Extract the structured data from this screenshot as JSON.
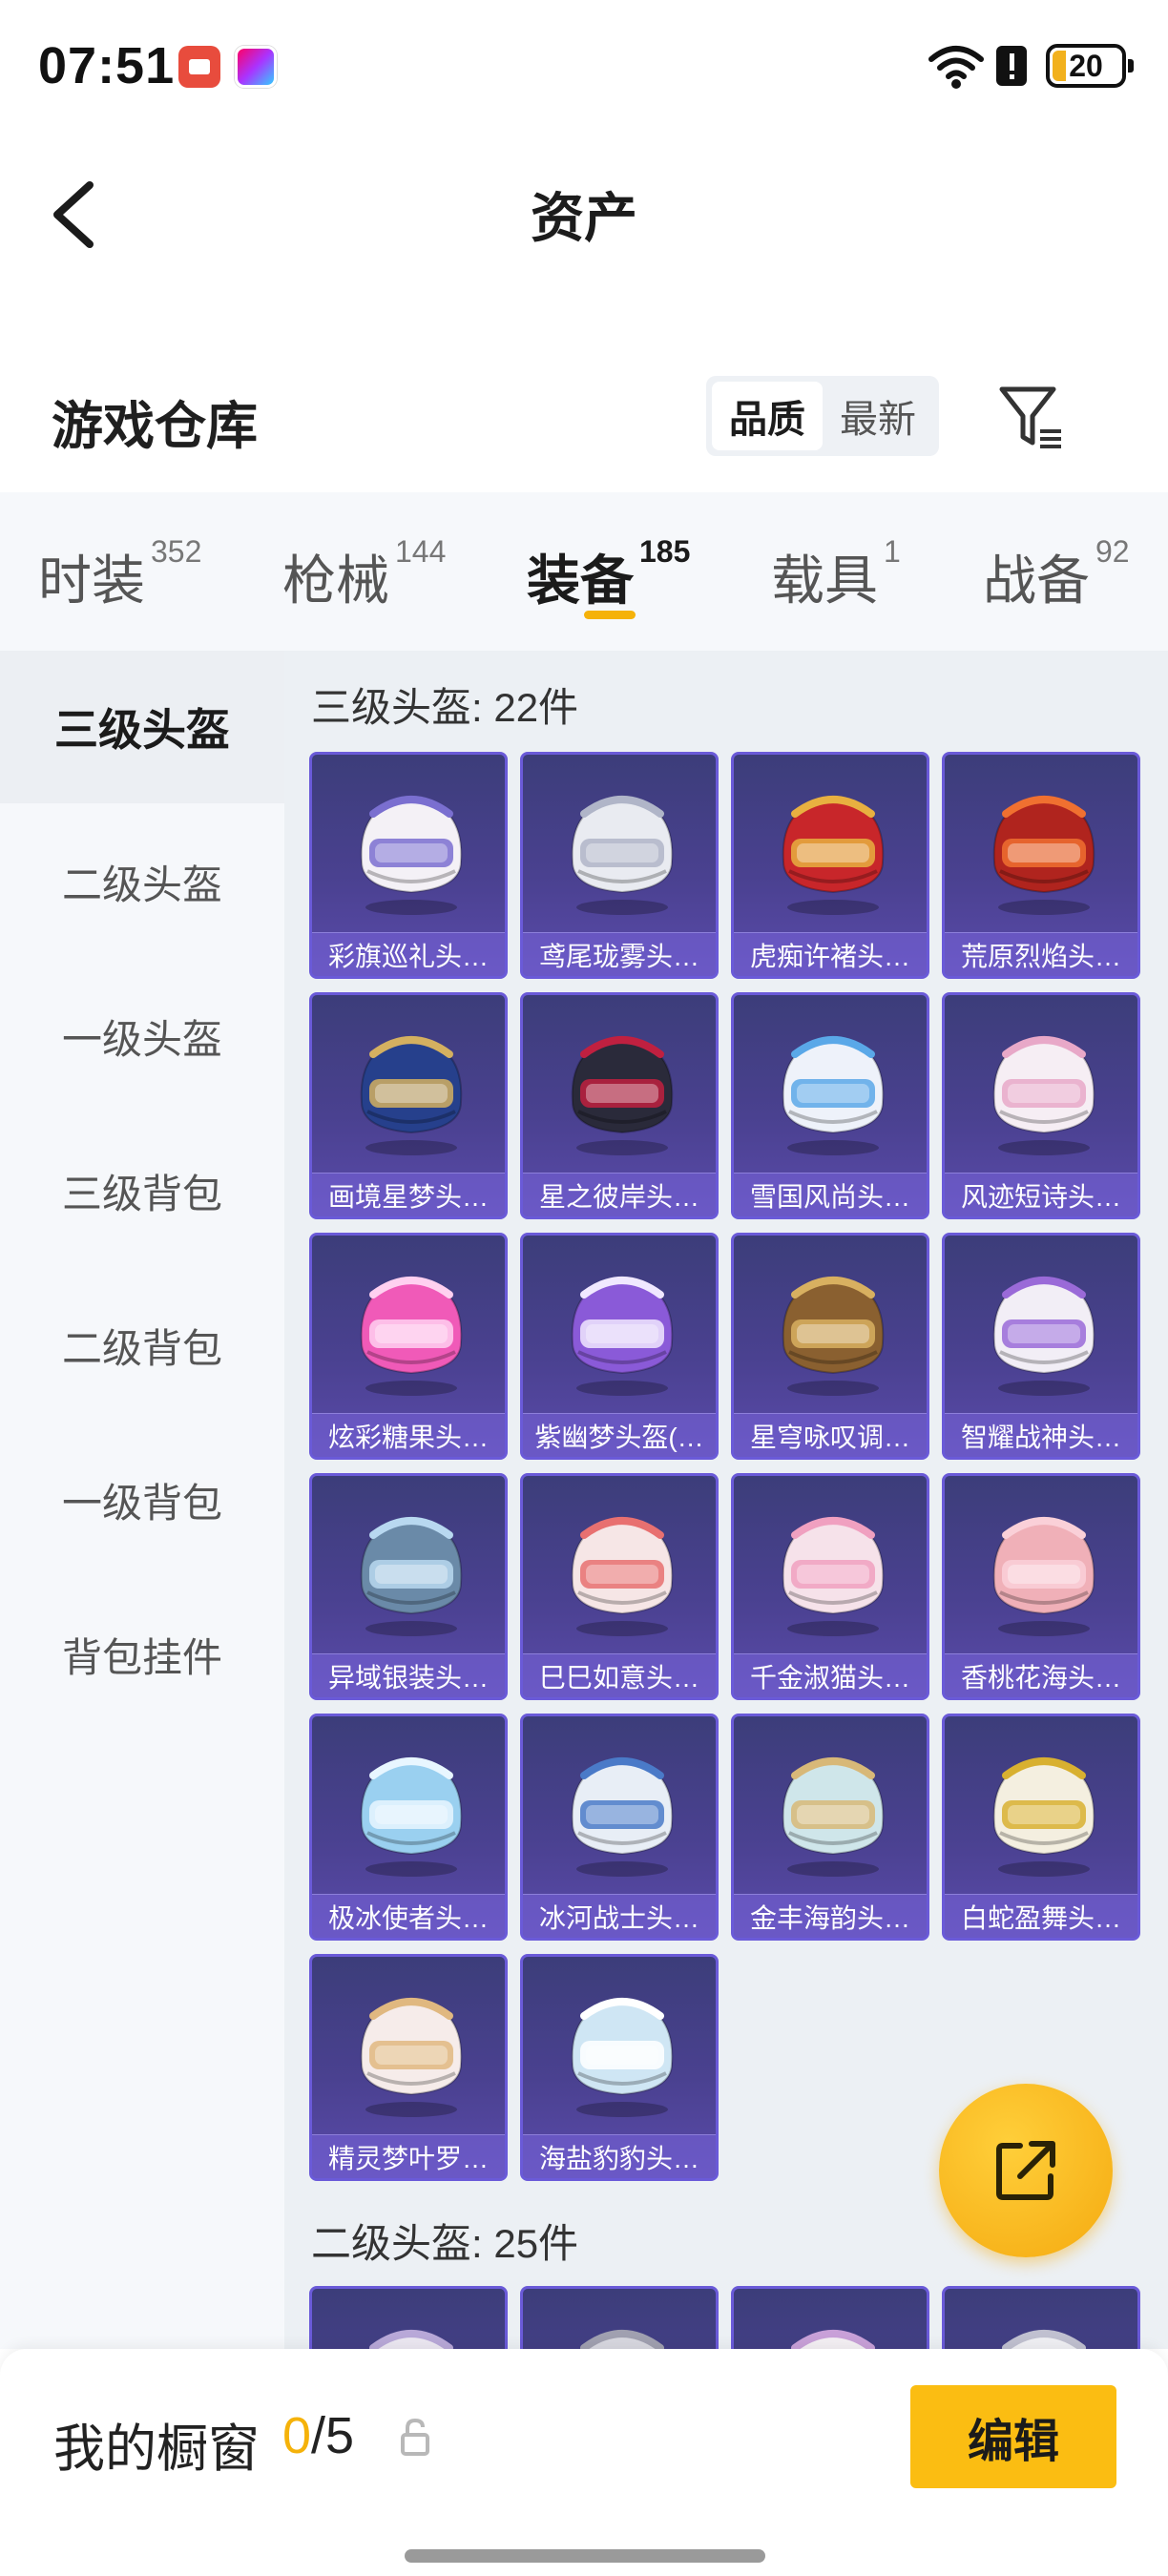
{
  "status_bar": {
    "time": "07:51",
    "battery": "20",
    "icons": [
      "recorder-app-icon",
      "app-icon",
      "wifi-icon",
      "alert-icon",
      "battery-icon"
    ]
  },
  "header": {
    "title": "资产",
    "back_icon": "chevron-left-icon"
  },
  "warehouse": {
    "title": "游戏仓库",
    "sort_options": [
      "品质",
      "最新"
    ],
    "sort_selected": "品质",
    "filter_icon": "filter-icon"
  },
  "tabs": [
    {
      "label": "时装",
      "count": "352"
    },
    {
      "label": "枪械",
      "count": "144"
    },
    {
      "label": "装备",
      "count": "185",
      "active": true
    },
    {
      "label": "载具",
      "count": "1"
    },
    {
      "label": "战备",
      "count": "92"
    }
  ],
  "sidebar": {
    "items": [
      "三级头盔",
      "二级头盔",
      "一级头盔",
      "三级背包",
      "二级背包",
      "一级背包",
      "背包挂件"
    ],
    "active": "三级头盔"
  },
  "sections": [
    {
      "title": "三级头盔: 22件",
      "items": [
        {
          "name": "彩旗巡礼头…",
          "color": "#f4f1f6",
          "accent": "#7a6fd0"
        },
        {
          "name": "鸢尾珑雾头…",
          "color": "#e9ebf1",
          "accent": "#b0b5c8"
        },
        {
          "name": "虎痴许褚头…",
          "color": "#c8262a",
          "accent": "#e8b040"
        },
        {
          "name": "荒原烈焰头…",
          "color": "#b0241e",
          "accent": "#f07030"
        },
        {
          "name": "画境星梦头…",
          "color": "#26408c",
          "accent": "#d4b060"
        },
        {
          "name": "星之彼岸头…",
          "color": "#2a2a3a",
          "accent": "#c02040"
        },
        {
          "name": "雪国风尚头…",
          "color": "#eef2fa",
          "accent": "#5aa8e8"
        },
        {
          "name": "风迹短诗头…",
          "color": "#f6eef4",
          "accent": "#e8a8c8"
        },
        {
          "name": "炫彩糖果头…",
          "color": "#f05ab8",
          "accent": "#ffd0f0"
        },
        {
          "name": "紫幽梦头盔(…",
          "color": "#8a5ad8",
          "accent": "#f0e8ff"
        },
        {
          "name": "星穹咏叹调…",
          "color": "#8a6030",
          "accent": "#d8b060"
        },
        {
          "name": "智耀战神头…",
          "color": "#f2eef6",
          "accent": "#9a6ad8"
        },
        {
          "name": "异域银装头…",
          "color": "#6a8aa8",
          "accent": "#b8d8f0"
        },
        {
          "name": "巳巳如意头…",
          "color": "#f6e6e6",
          "accent": "#e87070"
        },
        {
          "name": "千金淑猫头…",
          "color": "#f6e2ea",
          "accent": "#f0a0c0"
        },
        {
          "name": "香桃花海头…",
          "color": "#f0b0b8",
          "accent": "#fad0d8"
        },
        {
          "name": "极冰使者头…",
          "color": "#9ad0f0",
          "accent": "#e8f6ff"
        },
        {
          "name": "冰河战士头…",
          "color": "#e8eef6",
          "accent": "#4a7ac8"
        },
        {
          "name": "金丰海韵头…",
          "color": "#cfe6ea",
          "accent": "#d8b878"
        },
        {
          "name": "白蛇盈舞头…",
          "color": "#f4efe0",
          "accent": "#d8b030"
        },
        {
          "name": "精灵梦叶罗…",
          "color": "#f6ecea",
          "accent": "#e0b880"
        },
        {
          "name": "海盐豹豹头…",
          "color": "#cfe6f4",
          "accent": "#ffffff"
        }
      ]
    },
    {
      "title": "二级头盔: 25件",
      "items": [
        {
          "name": "",
          "color": "#ece8f2",
          "accent": "#b8a8d8"
        },
        {
          "name": "",
          "color": "#d8d8e0",
          "accent": "#a0a0b0"
        },
        {
          "name": "",
          "color": "#f4f0f4",
          "accent": "#c8a0d8"
        },
        {
          "name": "",
          "color": "#f0f0f4",
          "accent": "#c0c0d0"
        }
      ]
    }
  ],
  "bottom_bar": {
    "title": "我的橱窗",
    "count_current": "0",
    "count_sep_total": "/5",
    "edit_label": "编辑"
  }
}
